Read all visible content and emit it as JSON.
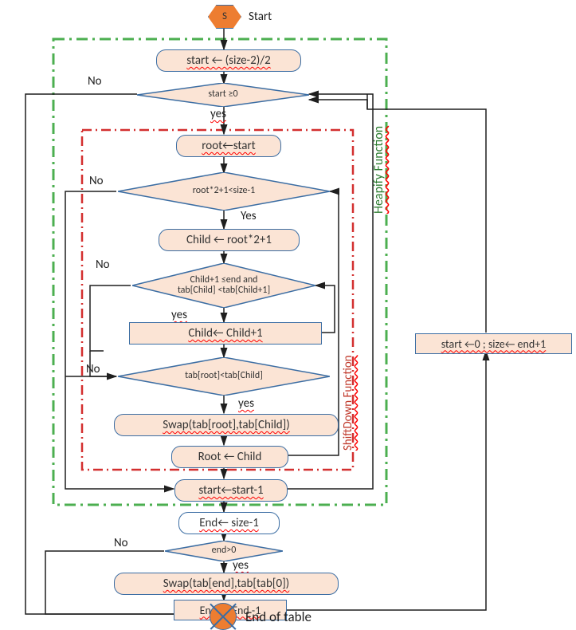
{
  "start": {
    "letter": "S",
    "label": "Start"
  },
  "heapify_label": "Heapify Function",
  "shiftdown_label": "ShiftDown Function",
  "boxes": {
    "start_assign": "start ← (size-2)/2",
    "start_cond": "start ≥0",
    "root_assign": "root←start",
    "root_cond": "root*2+1<size-1",
    "child_assign": "Child ← root*2+1",
    "child_cond": "Child+1 ≤end and\ntab[Child] <tab[Child+1]",
    "child_inc": "Child← Child+1",
    "swap_cond": "tab[root]<tab[Child]",
    "swap1": "Swap(tab[root],tab[Child])",
    "root_child": "Root ← Child",
    "start_dec": "start←start-1",
    "end_assign": "End← size-1",
    "end_cond": "end>0",
    "swap2": "Swap(tab[end],tab[tab[0])",
    "end_dec": "End ← End -1",
    "reset": "start ←0 ;   size← end+1",
    "end_of_table": "End of table"
  },
  "branch": {
    "yes": "yes",
    "Yes": "Yes",
    "no": "No"
  }
}
